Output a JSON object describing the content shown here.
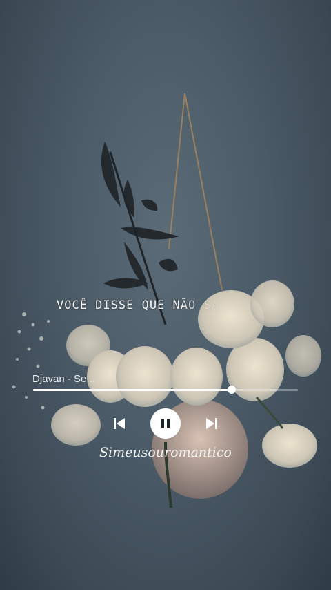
{
  "lyric": {
    "text": "VOCÊ DISSE QUE NÃO SA"
  },
  "player": {
    "song_title": "Djavan - Se...",
    "progress": 0.75,
    "controls": {
      "previous": "skip-previous-icon",
      "play_pause": "pause-icon",
      "next": "skip-next-icon"
    }
  },
  "watermark": {
    "text": "Simeusouromantico"
  },
  "colors": {
    "wall": "#4a5a66",
    "accent": "#ffffff",
    "track": "rgba(255,255,255,0.35)"
  }
}
